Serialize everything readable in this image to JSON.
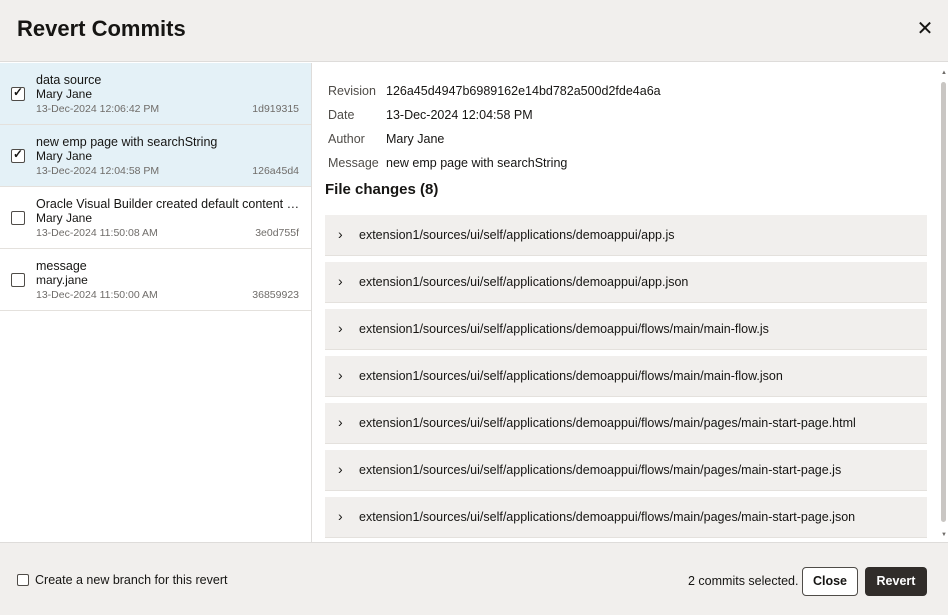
{
  "header": {
    "title": "Revert Commits",
    "close_glyph": "✕"
  },
  "commits": [
    {
      "message": "data source",
      "author": "Mary Jane",
      "date": "13-Dec-2024 12:06:42 PM",
      "hash": "1d919315",
      "checked": true
    },
    {
      "message": "new emp page with searchString",
      "author": "Mary Jane",
      "date": "13-Dec-2024 12:04:58 PM",
      "hash": "126a45d4",
      "checked": true
    },
    {
      "message": "Oracle Visual Builder created default content for application",
      "author": "Mary Jane",
      "date": "13-Dec-2024 11:50:08 AM",
      "hash": "3e0d755f",
      "checked": false
    },
    {
      "message": "message",
      "author": "mary.jane",
      "date": "13-Dec-2024 11:50:00 AM",
      "hash": "36859923",
      "checked": false
    }
  ],
  "details": {
    "revision_label": "Revision",
    "revision": "126a45d4947b6989162e14bd782a500d2fde4a6a",
    "date_label": "Date",
    "date": "13-Dec-2024 12:04:58 PM",
    "author_label": "Author",
    "author": "Mary Jane",
    "message_label": "Message",
    "message": "new emp page with searchString",
    "file_changes_title": "File changes (8)",
    "files": [
      "extension1/sources/ui/self/applications/demoappui/app.js",
      "extension1/sources/ui/self/applications/demoappui/app.json",
      "extension1/sources/ui/self/applications/demoappui/flows/main/main-flow.js",
      "extension1/sources/ui/self/applications/demoappui/flows/main/main-flow.json",
      "extension1/sources/ui/self/applications/demoappui/flows/main/pages/main-start-page.html",
      "extension1/sources/ui/self/applications/demoappui/flows/main/pages/main-start-page.js",
      "extension1/sources/ui/self/applications/demoappui/flows/main/pages/main-start-page.json"
    ]
  },
  "footer": {
    "branch_label": "Create a new branch for this revert",
    "selected_text": "2 commits selected.",
    "close_label": "Close",
    "revert_label": "Revert"
  },
  "icons": {
    "checkbox_tick": "checkmark-icon",
    "expand": "chevron-right-icon",
    "close": "close-icon"
  },
  "colors": {
    "selected_row": "#e4f1f7",
    "primary_button": "#312d2a",
    "panel_bg": "#f1efed"
  }
}
